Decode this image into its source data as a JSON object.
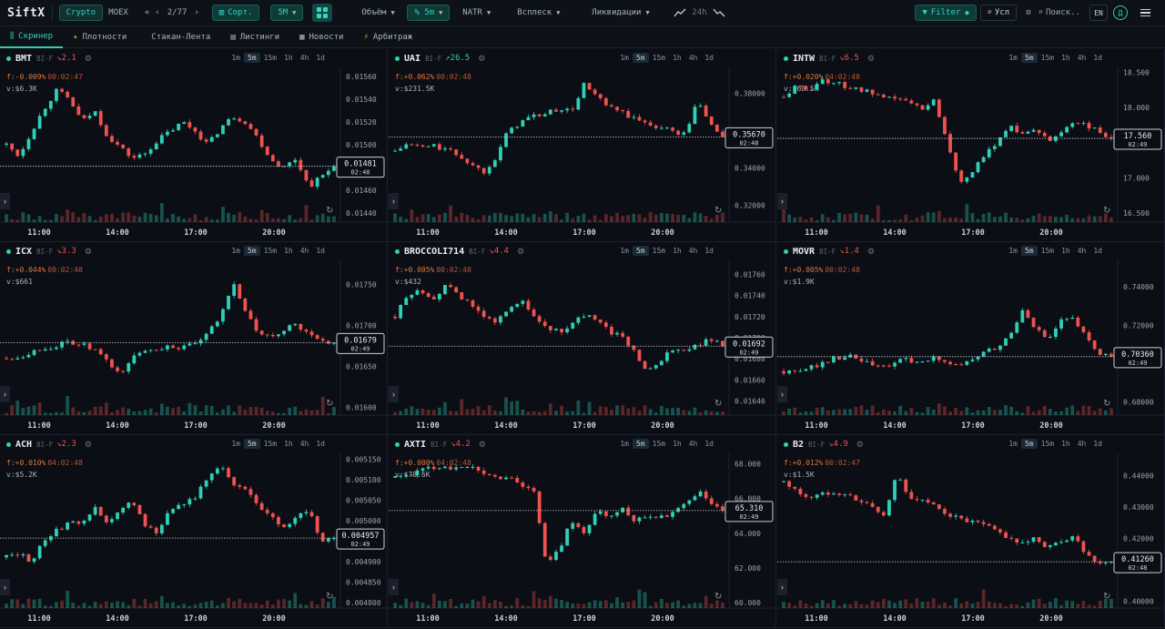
{
  "app": {
    "logo": "SiftX",
    "market_tabs": [
      "Crypto",
      "MOEX"
    ],
    "pager": {
      "prev": "«",
      "prev_one": "‹",
      "label": "2/77",
      "next_one": "›"
    },
    "sort_label": "Сорт.",
    "interval_label": "5M",
    "metrics": [
      {
        "label": "Объём",
        "active": false
      },
      {
        "label": "% 5m",
        "active": true
      },
      {
        "label": "NATR",
        "active": false
      },
      {
        "label": "Всплеск",
        "active": false
      },
      {
        "label": "Ликвидации",
        "active": false
      }
    ],
    "period_label": "24h",
    "filter_label": "Filter",
    "cond_label": "Усл",
    "search_placeholder": "Поиск..",
    "lang": "EN",
    "avatar_letter": "Д"
  },
  "nav": [
    {
      "label": "Скринер",
      "icon": "bars-icon",
      "glyph": "⫼",
      "active": true
    },
    {
      "label": "Плотности",
      "icon": "flame-icon",
      "glyph": "✦",
      "active": false
    },
    {
      "label": "Стакан-Лента",
      "icon": "book-icon",
      "glyph": "",
      "active": false
    },
    {
      "label": "Листинги",
      "icon": "list-icon",
      "glyph": "▤",
      "active": false
    },
    {
      "label": "Новости",
      "icon": "news-icon",
      "glyph": "▦",
      "active": false
    },
    {
      "label": "Арбитраж",
      "icon": "bolt-icon",
      "glyph": "⚡",
      "active": false
    }
  ],
  "timeframes": [
    "1m",
    "5m",
    "15m",
    "1h",
    "4h",
    "1d"
  ],
  "active_timeframe": "5m",
  "colors": {
    "up": "#2fd0b8",
    "down": "#f0524f",
    "accent": "#2fd0b8"
  },
  "panels": [
    {
      "symbol": "BMT",
      "exchange": "BI-F",
      "dir": "down",
      "change": "2.1",
      "funding": "f:-0.009%",
      "funding_time": "00:02:47",
      "volume": "v:$6.3K",
      "price_ticks": [
        "0.01560",
        "0.01540",
        "0.01520",
        "0.01500",
        "0.01480",
        "0.01460",
        "0.01440"
      ],
      "ylim": [
        0.01435,
        0.01565
      ],
      "last_price": 0.01481,
      "last_label": "0.01481",
      "countdown": "02:48",
      "time_ticks": [
        "11:00",
        "14:00",
        "17:00",
        "20:00"
      ],
      "series": [
        0.015,
        0.0149,
        0.01512,
        0.01532,
        0.01548,
        0.0154,
        0.0152,
        0.0153,
        0.01508,
        0.01498,
        0.01488,
        0.01492,
        0.01504,
        0.01512,
        0.0152,
        0.01512,
        0.015,
        0.01515,
        0.01525,
        0.0152,
        0.01505,
        0.01487,
        0.0148,
        0.01488,
        0.01463,
        0.01472,
        0.01481
      ]
    },
    {
      "symbol": "UAI",
      "exchange": "BI-F",
      "dir": "up",
      "change": "26.5",
      "funding": "f:+0.062%",
      "funding_time": "00:02:48",
      "volume": "v:$231.5K",
      "price_ticks": [
        "0.38000",
        "0.36000",
        "0.34000",
        "0.32000"
      ],
      "ylim": [
        0.313,
        0.392
      ],
      "last_price": 0.3567,
      "last_label": "0.35670",
      "countdown": "02:48",
      "time_ticks": [
        "11:00",
        "14:00",
        "17:00",
        "20:00"
      ],
      "series": [
        0.349,
        0.353,
        0.351,
        0.352,
        0.35,
        0.347,
        0.342,
        0.338,
        0.346,
        0.36,
        0.365,
        0.368,
        0.369,
        0.372,
        0.37,
        0.385,
        0.378,
        0.372,
        0.37,
        0.366,
        0.364,
        0.362,
        0.36,
        0.358,
        0.376,
        0.364,
        0.3567
      ]
    },
    {
      "symbol": "INTW",
      "exchange": "BI-F",
      "dir": "down",
      "change": "6.5",
      "funding": "f:+0.020%",
      "funding_time": "04:02:48",
      "volume": "v:$68.5K",
      "price_ticks": [
        "18.500",
        "18.000",
        "17.500",
        "17.000",
        "16.500"
      ],
      "ylim": [
        16.42,
        18.52
      ],
      "last_price": 17.56,
      "last_label": "17.560",
      "countdown": "02:49",
      "time_ticks": [
        "11:00",
        "14:00",
        "17:00",
        "20:00"
      ],
      "series": [
        18.15,
        18.3,
        18.25,
        18.4,
        18.35,
        18.3,
        18.25,
        18.2,
        18.1,
        18.15,
        18.05,
        18.0,
        18.1,
        17.5,
        16.95,
        17.1,
        17.3,
        17.55,
        17.75,
        17.6,
        17.7,
        17.5,
        17.65,
        17.8,
        17.75,
        17.65,
        17.56
      ]
    },
    {
      "symbol": "ICX",
      "exchange": "BI-F",
      "dir": "down",
      "change": "3.3",
      "funding": "f:+0.044%",
      "funding_time": "00:02:48",
      "volume": "v:$661",
      "price_ticks": [
        "0.01750",
        "0.01700",
        "0.01650",
        "0.01600"
      ],
      "ylim": [
        0.01595,
        0.01775
      ],
      "last_price": 0.01679,
      "last_label": "0.01679",
      "countdown": "02:49",
      "time_ticks": [
        "11:00",
        "14:00",
        "17:00",
        "20:00"
      ],
      "series": [
        0.0166,
        0.01662,
        0.01668,
        0.01672,
        0.01675,
        0.0168,
        0.01676,
        0.0167,
        0.01655,
        0.0164,
        0.0166,
        0.0167,
        0.01672,
        0.01675,
        0.01672,
        0.01677,
        0.0169,
        0.0171,
        0.01755,
        0.01715,
        0.0169,
        0.01685,
        0.01695,
        0.017,
        0.01688,
        0.01682,
        0.01679
      ]
    },
    {
      "symbol": "BROCCOLI714",
      "exchange": "BI-F",
      "dir": "down",
      "change": "4.4",
      "funding": "f:+0.005%",
      "funding_time": "00:02:48",
      "volume": "v:$432",
      "price_ticks": [
        "0.01760",
        "0.01740",
        "0.01720",
        "0.01700",
        "0.01680",
        "0.01660",
        "0.01640"
      ],
      "ylim": [
        0.0163,
        0.0177
      ],
      "last_price": 0.01692,
      "last_label": "0.01692",
      "countdown": "02:49",
      "time_ticks": [
        "11:00",
        "14:00",
        "17:00",
        "20:00"
      ],
      "series": [
        0.0172,
        0.0174,
        0.01745,
        0.01738,
        0.01748,
        0.01742,
        0.0173,
        0.01722,
        0.01712,
        0.0173,
        0.01735,
        0.0172,
        0.0171,
        0.01705,
        0.01712,
        0.01722,
        0.01715,
        0.01706,
        0.017,
        0.01688,
        0.01668,
        0.01675,
        0.0169,
        0.01688,
        0.01692,
        0.01698,
        0.01692
      ]
    },
    {
      "symbol": "MOVR",
      "exchange": "BI-F",
      "dir": "down",
      "change": "1.4",
      "funding": "f:+0.005%",
      "funding_time": "00:02:48",
      "volume": "v:$1.9K",
      "price_ticks": [
        "0.74000",
        "0.72000",
        "0.70000",
        "0.68000"
      ],
      "ylim": [
        0.675,
        0.752
      ],
      "last_price": 0.7036,
      "last_label": "0.70360",
      "countdown": "02:49",
      "time_ticks": [
        "11:00",
        "14:00",
        "17:00",
        "20:00"
      ],
      "series": [
        0.696,
        0.695,
        0.698,
        0.7,
        0.703,
        0.704,
        0.702,
        0.699,
        0.698,
        0.701,
        0.702,
        0.7,
        0.703,
        0.701,
        0.699,
        0.702,
        0.706,
        0.708,
        0.715,
        0.729,
        0.718,
        0.712,
        0.722,
        0.723,
        0.713,
        0.705,
        0.7036
      ]
    },
    {
      "symbol": "ACH",
      "exchange": "BI-F",
      "dir": "down",
      "change": "2.3",
      "funding": "f:+0.010%",
      "funding_time": "04:02:48",
      "volume": "v:$5.2K",
      "price_ticks": [
        "0.005150",
        "0.005100",
        "0.005050",
        "0.005000",
        "0.004950",
        "0.004900",
        "0.004850",
        "0.004800"
      ],
      "ylim": [
        0.004795,
        0.005155
      ],
      "last_price": 0.004957,
      "last_label": "0.004957",
      "countdown": "02:49",
      "time_ticks": [
        "11:00",
        "14:00",
        "17:00",
        "20:00"
      ],
      "series": [
        0.00491,
        0.00492,
        0.0049,
        0.00495,
        0.00498,
        0.00499,
        0.005,
        0.00503,
        0.00499,
        0.00502,
        0.00505,
        0.00499,
        0.00497,
        0.00503,
        0.00504,
        0.00506,
        0.0051,
        0.00513,
        0.00509,
        0.00508,
        0.00504,
        0.00501,
        0.00498,
        0.00501,
        0.00503,
        0.00495,
        0.004957
      ]
    },
    {
      "symbol": "AXTI",
      "exchange": "BI-F",
      "dir": "down",
      "change": "4.2",
      "funding": "f:+0.000%",
      "funding_time": "04:02:48",
      "volume": "v:$78.6K",
      "price_ticks": [
        "68.000",
        "66.000",
        "64.000",
        "62.000",
        "60.000"
      ],
      "ylim": [
        59.9,
        68.4
      ],
      "last_price": 65.31,
      "last_label": "65.310",
      "countdown": "02:49",
      "time_ticks": [
        "11:00",
        "14:00",
        "17:00",
        "20:00"
      ],
      "series": [
        67.2,
        67.4,
        67.6,
        67.8,
        67.9,
        67.7,
        67.8,
        67.5,
        67.2,
        67.3,
        66.8,
        66.5,
        62.2,
        63.0,
        64.8,
        64.0,
        65.2,
        65.0,
        65.4,
        64.8,
        65.1,
        64.9,
        65.2,
        65.6,
        66.4,
        65.8,
        65.31
      ]
    },
    {
      "symbol": "B2",
      "exchange": "BI-F",
      "dir": "down",
      "change": "4.9",
      "funding": "f:+0.012%",
      "funding_time": "00:02:47",
      "volume": "v:$1.5K",
      "price_ticks": [
        "0.44000",
        "0.43000",
        "0.42000",
        "0.41000",
        "0.40000"
      ],
      "ylim": [
        0.399,
        0.446
      ],
      "last_price": 0.4126,
      "last_label": "0.41260",
      "countdown": "02:48",
      "time_ticks": [
        "11:00",
        "14:00",
        "17:00",
        "20:00"
      ],
      "series": [
        0.438,
        0.435,
        0.433,
        0.434,
        0.435,
        0.434,
        0.432,
        0.43,
        0.427,
        0.441,
        0.433,
        0.432,
        0.43,
        0.428,
        0.426,
        0.425,
        0.424,
        0.422,
        0.42,
        0.418,
        0.42,
        0.417,
        0.419,
        0.421,
        0.415,
        0.4125,
        0.4126
      ]
    }
  ]
}
